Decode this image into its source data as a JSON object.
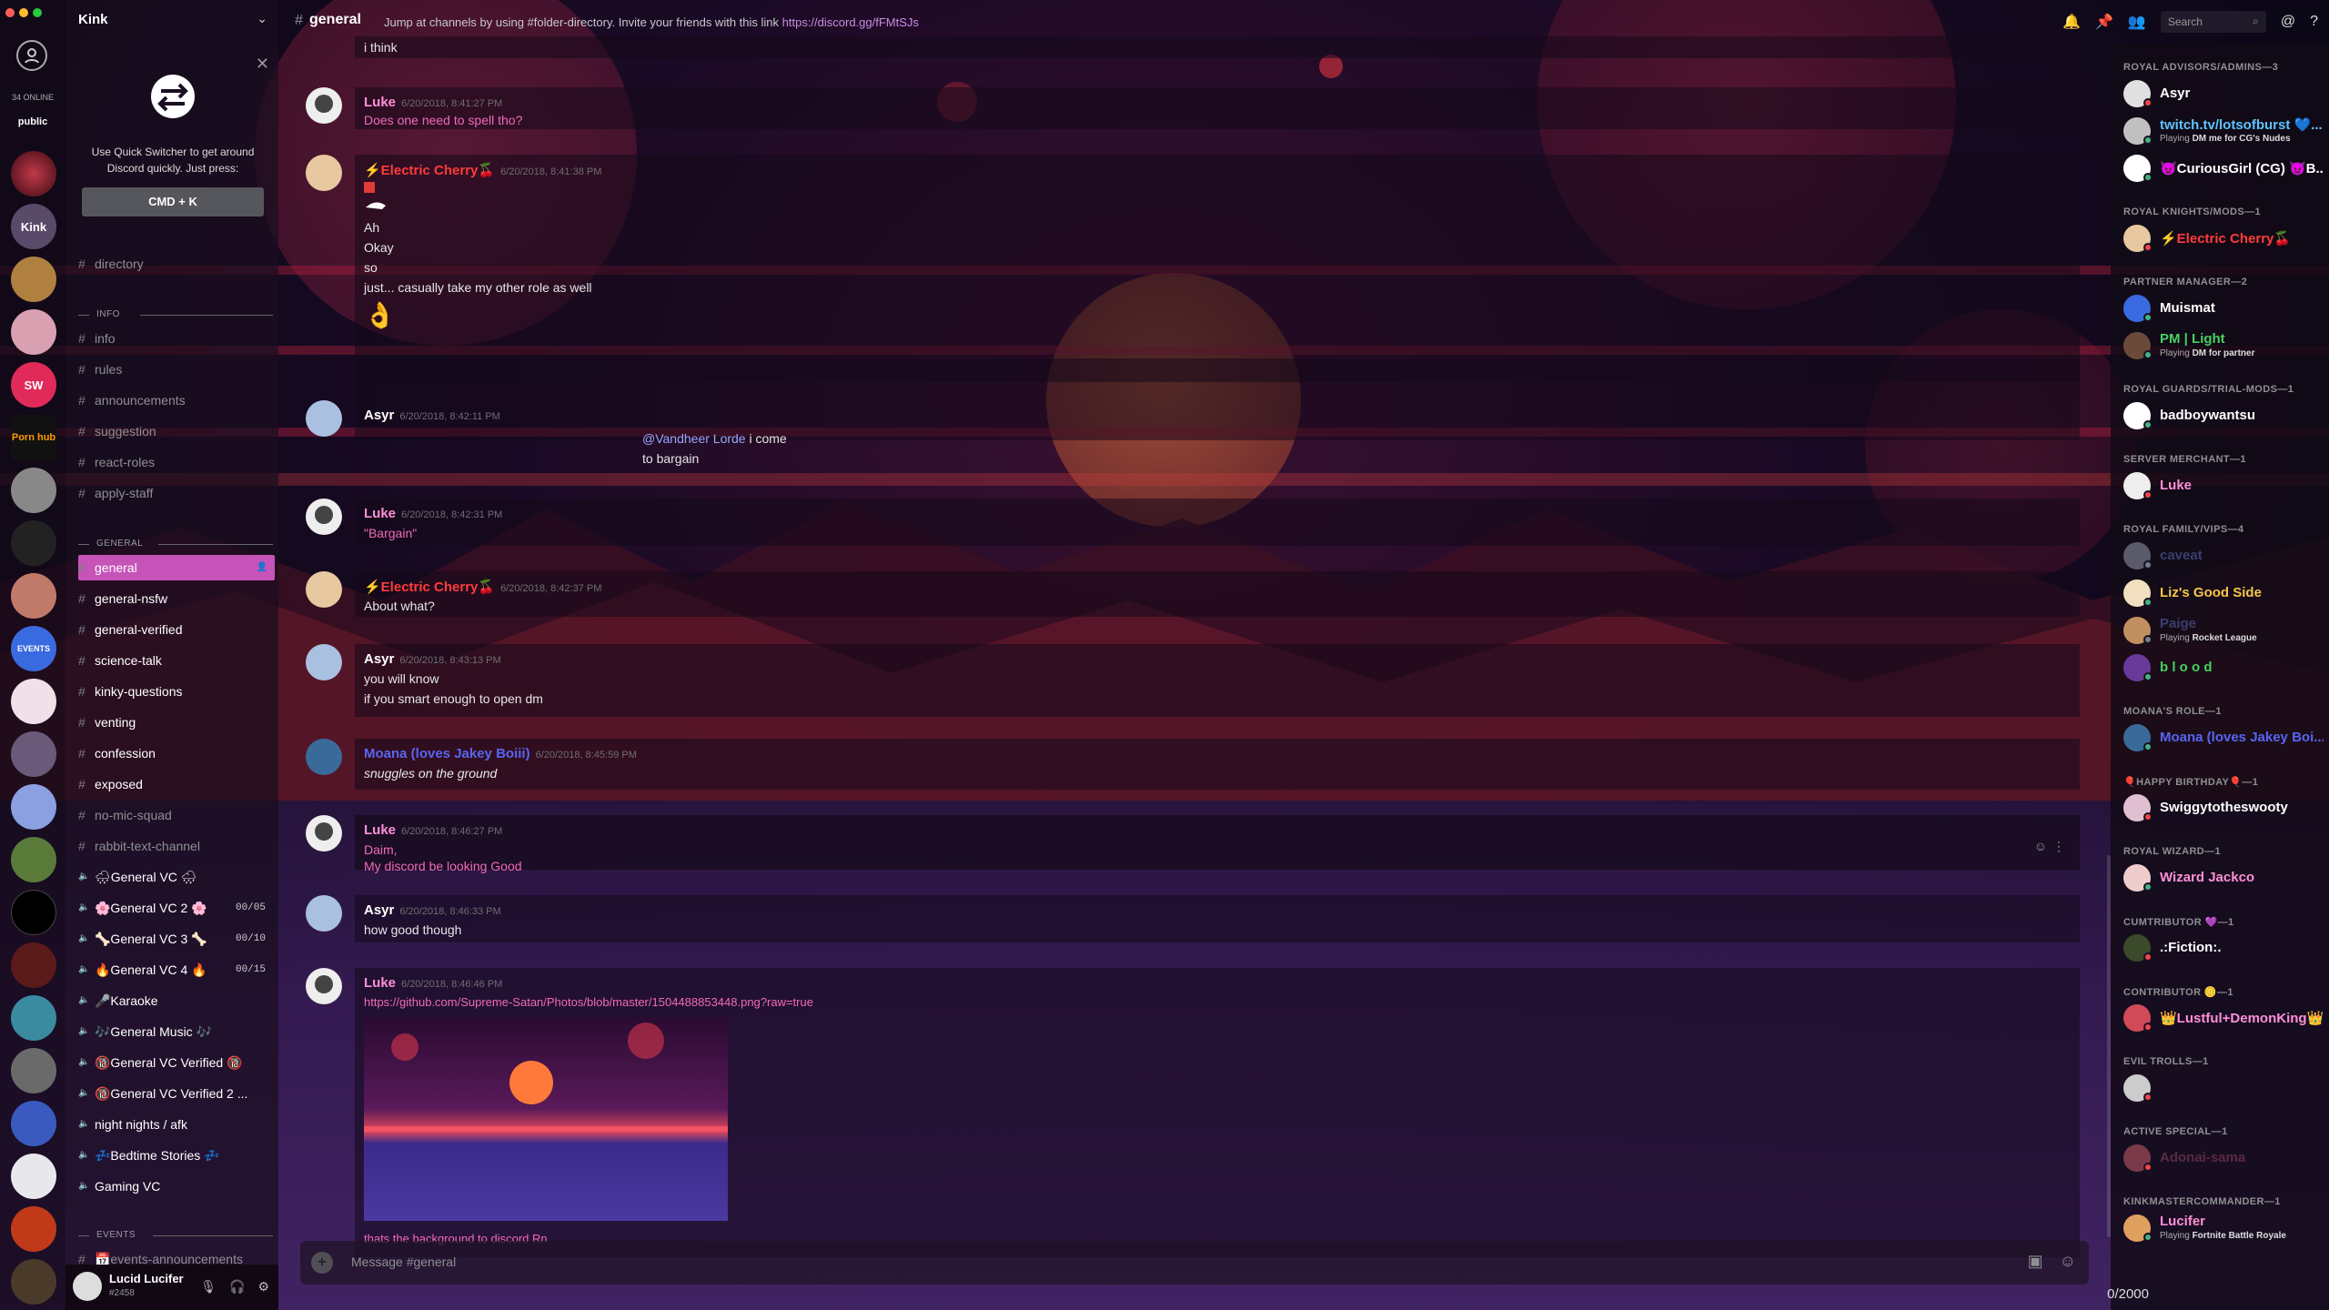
{
  "app": {
    "title": "Kink"
  },
  "rail": {
    "online_text": "34 ONLINE",
    "public_label": "public",
    "server_labels": [
      "Kink",
      "Porn hub",
      "SW",
      "EVENTS"
    ]
  },
  "quick_switcher": {
    "text_line1": "Use Quick Switcher to get around",
    "text_line2": "Discord quickly. Just press:",
    "shortcut": "CMD + K"
  },
  "channels": {
    "top": [
      {
        "name": "directory"
      }
    ],
    "cat_info": "INFO",
    "info": [
      {
        "name": "info"
      },
      {
        "name": "rules"
      },
      {
        "name": "announcements"
      },
      {
        "name": "suggestion"
      },
      {
        "name": "react-roles"
      },
      {
        "name": "apply-staff"
      }
    ],
    "cat_general": "GENERAL",
    "general": [
      {
        "name": "general",
        "active": true
      },
      {
        "name": "general-nsfw",
        "bright": true
      },
      {
        "name": "general-verified",
        "bright": true
      },
      {
        "name": "science-talk",
        "bright": true
      },
      {
        "name": "kinky-questions",
        "bright": true
      },
      {
        "name": "venting",
        "bright": true
      },
      {
        "name": "confession",
        "bright": true
      },
      {
        "name": "exposed",
        "bright": true
      },
      {
        "name": "no-mic-squad",
        "bright": false
      },
      {
        "name": "rabbit-text-channel",
        "bright": false
      }
    ],
    "voice": [
      {
        "name": "🌧General VC 🌧",
        "count": ""
      },
      {
        "name": "🌸General VC 2 🌸",
        "count": "00/05"
      },
      {
        "name": "🦴General VC 3 🦴",
        "count": "00/10"
      },
      {
        "name": "🔥General VC 4 🔥",
        "count": "00/15"
      },
      {
        "name": "🎤Karaoke",
        "count": ""
      },
      {
        "name": "🎶General Music 🎶",
        "count": ""
      },
      {
        "name": "🔞General VC Verified 🔞",
        "count": ""
      },
      {
        "name": "🔞General VC Verified 2 ...",
        "count": ""
      },
      {
        "name": "night nights / afk",
        "count": ""
      },
      {
        "name": "💤Bedtime Stories 💤",
        "count": ""
      },
      {
        "name": "Gaming VC",
        "count": ""
      }
    ],
    "cat_events": "EVENTS",
    "events_partial": "📅events-announcements"
  },
  "user": {
    "name": "Lucid Lucifer",
    "discriminator": "#2458"
  },
  "header": {
    "channel": "general",
    "topic": "Jump at channels by using #folder-directory. Invite your friends with this link",
    "topic_link": "https://discord.gg/fFMtSJs",
    "search_placeholder": "Search"
  },
  "messages": [
    {
      "author": "",
      "time": "",
      "lines": [
        "i think"
      ]
    },
    {
      "author": "Luke",
      "time": "6/20/2018, 8:41:27 PM",
      "lines": [
        "Does one need to spell tho?"
      ]
    },
    {
      "author": "⚡Electric Cherry🍒",
      "time": "6/20/2018, 8:41:38 PM",
      "lines": [
        "Ah",
        "Okay",
        "so",
        "just... casually take my other role as well",
        "👌"
      ]
    },
    {
      "author": "Asyr",
      "time": "6/20/2018, 8:42:11 PM",
      "lines": [
        "@Vandheer Lorde",
        " i come",
        "to bargain"
      ]
    },
    {
      "author": "Luke",
      "time": "6/20/2018, 8:42:31 PM",
      "lines": [
        "\"Bargain\""
      ]
    },
    {
      "author": "⚡Electric Cherry🍒",
      "time": "6/20/2018, 8:42:37 PM",
      "lines": [
        "About what?"
      ]
    },
    {
      "author": "Asyr",
      "time": "6/20/2018, 8:43:13 PM",
      "lines": [
        "you will know",
        "if you smart enough to open dm"
      ]
    },
    {
      "author": "Moana (loves Jakey Boiii)",
      "time": "6/20/2018, 8:45:59 PM",
      "lines": [
        "snuggles on the ground"
      ]
    },
    {
      "author": "Luke",
      "time": "6/20/2018, 8:46:27 PM",
      "lines": [
        "Daim,",
        "My discord be looking Good"
      ]
    },
    {
      "author": "Asyr",
      "time": "6/20/2018, 8:46:33 PM",
      "lines": [
        "how good though"
      ]
    },
    {
      "author": "Luke",
      "time": "6/20/2018, 8:46:46 PM",
      "lines": [
        "https://github.com/Supreme-Satan/Photos/blob/master/1504488853448.png?raw=true",
        "thats the background to discord Rn"
      ]
    }
  ],
  "composer": {
    "placeholder": "Message #general",
    "counter": "0/2000"
  },
  "members": {
    "roles": [
      {
        "label": "ROYAL ADVISORS/ADMINS—3",
        "people": [
          {
            "name": "Asyr",
            "color": "#ffffff",
            "sub": "",
            "sub_bold": ""
          },
          {
            "name": "twitch.tv/lotsofburst 💙...",
            "color": "#5ec4ff",
            "sub": "Playing ",
            "sub_bold": "DM me for CG's Nudes"
          },
          {
            "name": "😈CuriousGirl (CG) 😈B...",
            "color": "#ffffff",
            "sub": "",
            "sub_bold": ""
          }
        ]
      },
      {
        "label": "ROYAL KNIGHTS/MODS—1",
        "people": [
          {
            "name": "⚡Electric Cherry🍒",
            "color": "#ff3b3b",
            "sub": "",
            "sub_bold": ""
          }
        ]
      },
      {
        "label": "PARTNER MANAGER—2",
        "people": [
          {
            "name": "Muismat",
            "color": "#ffffff",
            "sub": "",
            "sub_bold": ""
          },
          {
            "name": "PM | Light",
            "color": "#46d160",
            "sub": "Playing ",
            "sub_bold": "DM for partner"
          }
        ]
      },
      {
        "label": "ROYAL GUARDS/TRIAL-MODS—1",
        "people": [
          {
            "name": "badboywantsu",
            "color": "#ffffff",
            "sub": "",
            "sub_bold": ""
          }
        ]
      },
      {
        "label": "SERVER MERCHANT—1",
        "people": [
          {
            "name": "Luke",
            "color": "#ff8fd8",
            "sub": "",
            "sub_bold": ""
          }
        ]
      },
      {
        "label": "ROYAL FAMILY/VIPS—4",
        "people": [
          {
            "name": "caveat",
            "color": "#3a3f6e",
            "sub": "",
            "sub_bold": ""
          },
          {
            "name": "Liz's Good Side",
            "color": "#f5c64a",
            "sub": "",
            "sub_bold": ""
          },
          {
            "name": "Paige",
            "color": "#3a3f6e",
            "sub": "Playing ",
            "sub_bold": "Rocket League"
          },
          {
            "name": "b l o o d",
            "color": "#46d160",
            "sub": "",
            "sub_bold": ""
          }
        ]
      },
      {
        "label": "MOANA'S ROLE—1",
        "people": [
          {
            "name": "Moana (loves Jakey Boi...",
            "color": "#5865f2",
            "sub": "",
            "sub_bold": ""
          }
        ]
      },
      {
        "label": "🎈HAPPY BIRTHDAY🎈—1",
        "people": [
          {
            "name": "Swiggytotheswooty",
            "color": "#ffffff",
            "sub": "",
            "sub_bold": ""
          }
        ]
      },
      {
        "label": "ROYAL WIZARD—1",
        "people": [
          {
            "name": "Wizard Jackco",
            "color": "#ff8fd8",
            "sub": "",
            "sub_bold": ""
          }
        ]
      },
      {
        "label": "CUMTRIBUTOR 💜—1",
        "people": [
          {
            "name": ".:Fiction:.",
            "color": "#ffffff",
            "sub": "",
            "sub_bold": ""
          }
        ]
      },
      {
        "label": "CONTRIBUTOR 🪙—1",
        "people": [
          {
            "name": "👑Lustful+DemonKing👑",
            "color": "#ff8fd8",
            "sub": "",
            "sub_bold": ""
          }
        ]
      },
      {
        "label": "EVIL TROLLS—1",
        "people": [
          {
            "name": "",
            "color": "#ffffff",
            "sub": "",
            "sub_bold": ""
          }
        ]
      },
      {
        "label": "ACTIVE SPECIAL—1",
        "people": [
          {
            "name": "Adonai-sama",
            "color": "#5a2a44",
            "sub": "",
            "sub_bold": ""
          }
        ]
      },
      {
        "label": "KINKMASTERCOMMANDER—1",
        "people": [
          {
            "name": "Lucifer",
            "color": "#ff8fd8",
            "sub": "Playing ",
            "sub_bold": "Fortnite Battle Royale"
          }
        ]
      }
    ]
  },
  "colors": {
    "accent": "#c653b8",
    "author_luke": "#ff8fd8",
    "author_cherry": "#ff3b3b",
    "author_asyr": "#ffffff",
    "author_moana": "#5865f2",
    "link": "#c98de2"
  }
}
